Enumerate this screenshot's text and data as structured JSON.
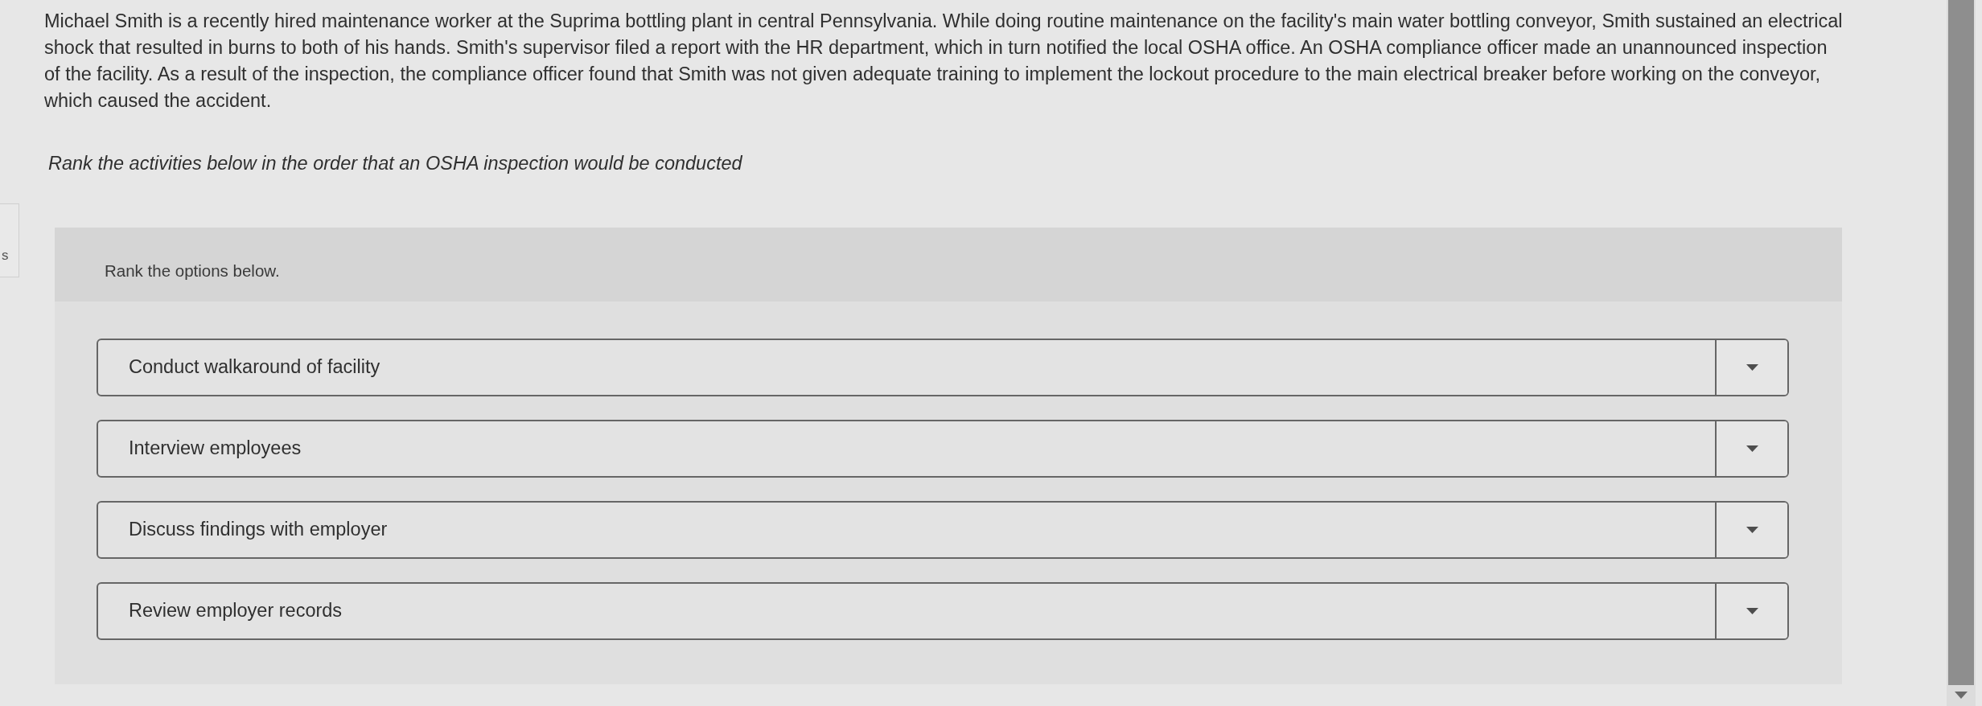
{
  "side_tab": {
    "text": "s"
  },
  "problem": {
    "text": "Michael Smith is a recently hired maintenance worker at the Suprima bottling plant in central Pennsylvania. While doing routine maintenance on the facility's main water bottling conveyor, Smith sustained an electrical shock that resulted in burns to both of his hands. Smith's supervisor filed a report with the HR department, which in turn notified the local OSHA office. An OSHA compliance officer made an unannounced inspection of the facility. As a result of the inspection, the compliance officer found that Smith was not given adequate training to implement the lockout procedure to the main electrical breaker before working on the conveyor, which caused the accident.",
    "prompt": "Rank the activities below in the order that an OSHA inspection would be conducted"
  },
  "ranking": {
    "instruction": "Rank the options below.",
    "options": [
      {
        "label": "Conduct walkaround of facility"
      },
      {
        "label": "Interview employees"
      },
      {
        "label": "Discuss findings with employer"
      },
      {
        "label": "Review employer records"
      }
    ]
  }
}
